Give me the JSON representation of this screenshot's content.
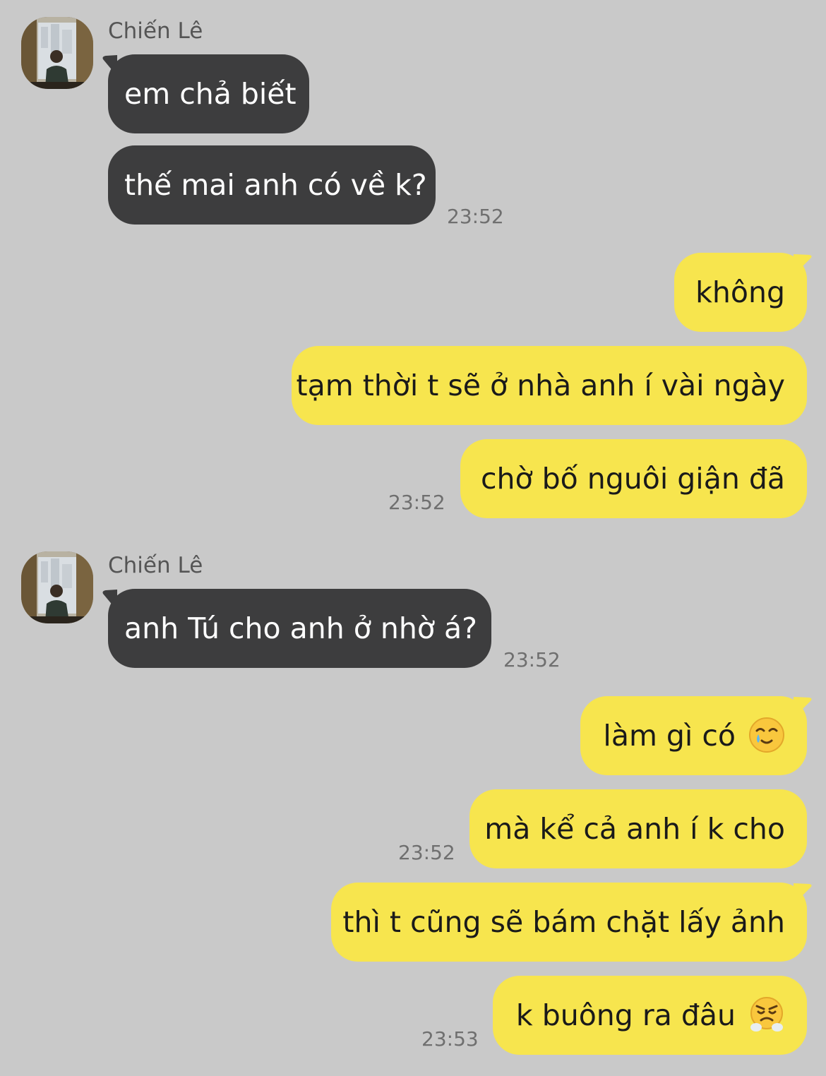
{
  "colors": {
    "background": "#c9c9c9",
    "incoming_bubble": "#3d3d3e",
    "outgoing_bubble": "#f7e54e"
  },
  "messages": [
    {
      "sender": "Chiến Lê",
      "avatar": "avatar-photo",
      "bubbles": [
        "em chả biết",
        "thế mai anh có về k?"
      ],
      "time": "23:52"
    },
    {
      "sender": "me",
      "bubbles": [
        "không",
        "tạm thời t sẽ ở nhà anh í vài ngày",
        "chờ bố nguôi giận đã"
      ],
      "time": "23:52"
    },
    {
      "sender": "Chiến Lê",
      "avatar": "avatar-photo",
      "bubbles": [
        "anh Tú cho anh ở nhờ á?"
      ],
      "time": "23:52"
    },
    {
      "sender": "me",
      "bubbles": [
        "làm gì có",
        "mà kể cả anh í k cho"
      ],
      "emoji_0": "smiling-face-with-tear-emoji",
      "time": "23:52"
    },
    {
      "sender": "me",
      "bubbles": [
        "thì t cũng sẽ bám chặt lấy ảnh",
        "k buông ra đâu"
      ],
      "emoji_1": "face-with-steam-from-nose-emoji",
      "time": "23:53"
    }
  ]
}
